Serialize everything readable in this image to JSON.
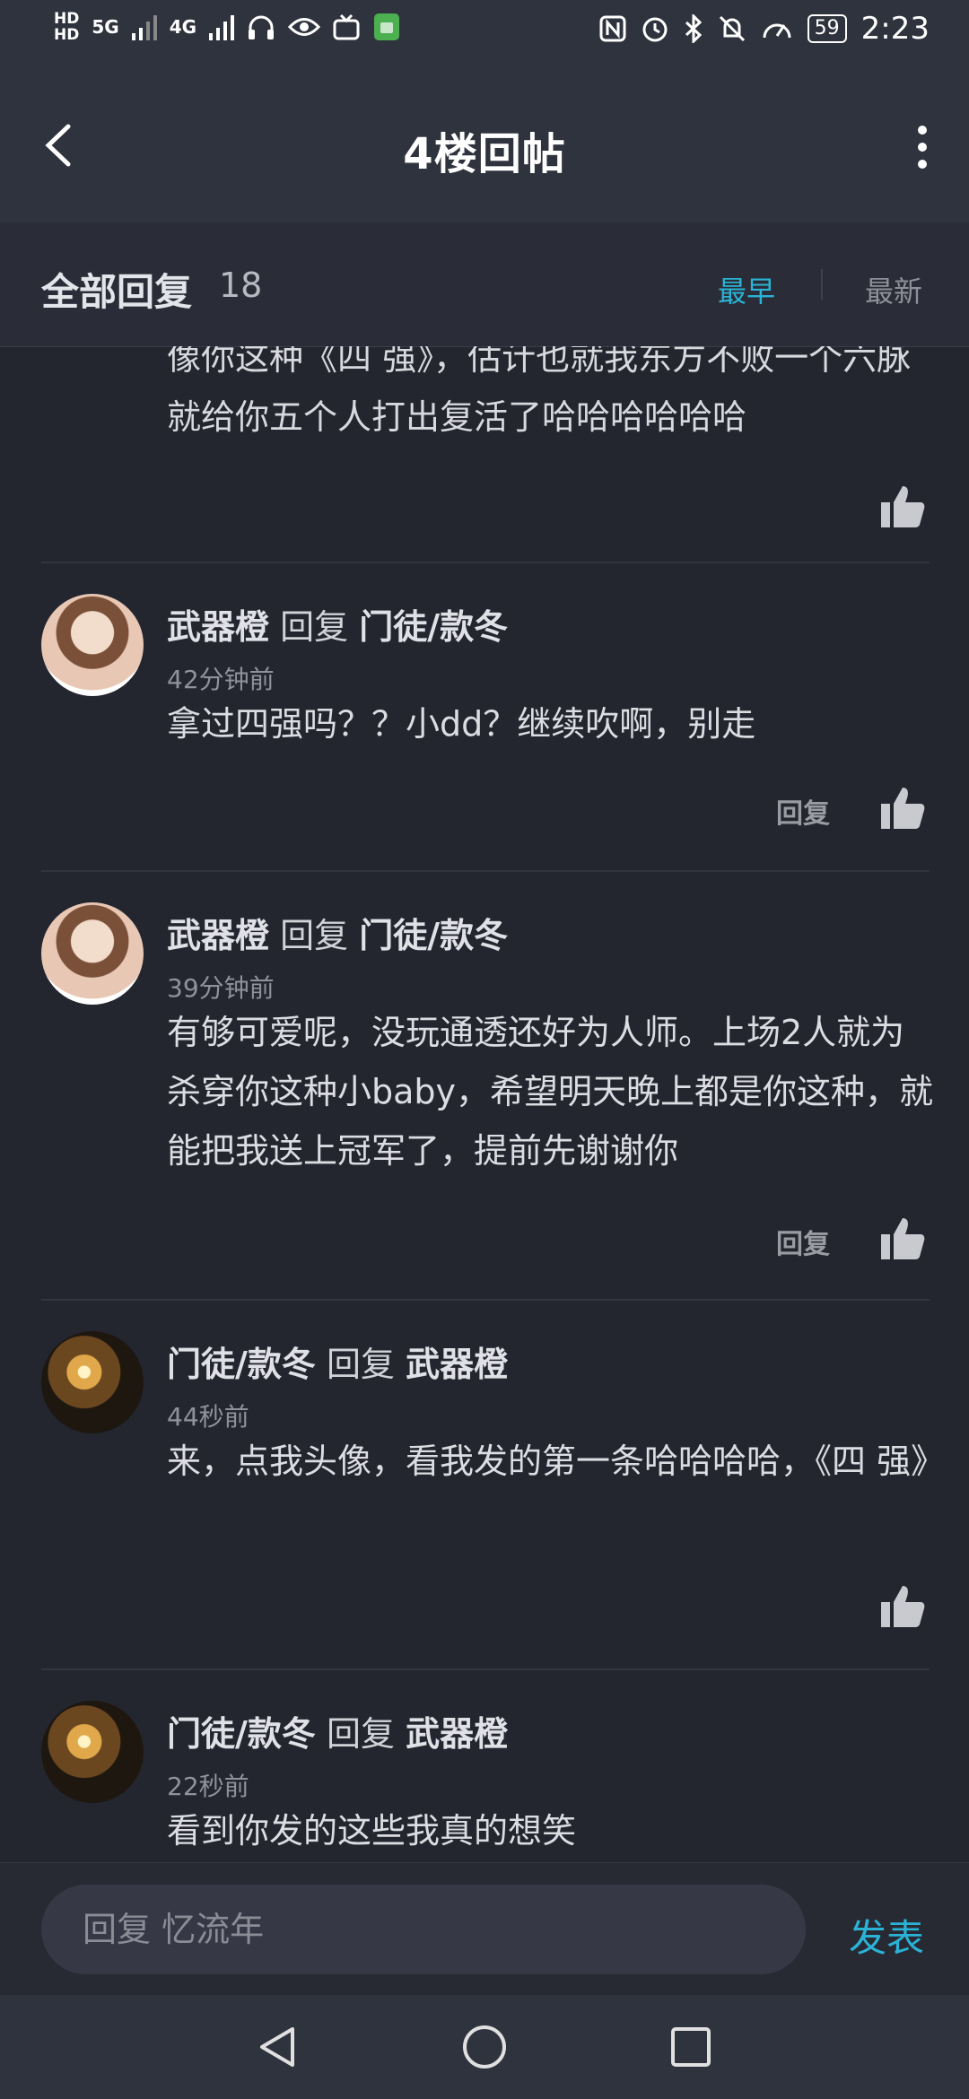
{
  "status_bar": {
    "hd1": "HD",
    "hd2": "HD",
    "sig1": "5G",
    "sig2": "4G",
    "battery": "59",
    "time": "2:23"
  },
  "header": {
    "title": "4楼回帖"
  },
  "subheader": {
    "all_replies": "全部回复",
    "count": "18",
    "tab_earliest": "最早",
    "tab_newest": "最新",
    "active_tab_color": "#2ab3d6"
  },
  "partial_comment": {
    "text": "像你这种《四 强》，估计也就我东方不败一个六脉就给你五个人打出复活了哈哈哈哈哈哈"
  },
  "comments": [
    {
      "user": "武器橙",
      "reply_word": "回复",
      "target": "门徒/款冬",
      "time": "42分钟前",
      "text": "拿过四强吗？？小dd？继续吹啊，别走",
      "reply_label": "回复"
    },
    {
      "user": "武器橙",
      "reply_word": "回复",
      "target": "门徒/款冬",
      "time": "39分钟前",
      "text": "有够可爱呢，没玩通透还好为人师。上场2人就为杀穿你这种小baby，希望明天晚上都是你这种，就能把我送上冠军了，提前先谢谢你",
      "reply_label": "回复"
    },
    {
      "user": "门徒/款冬",
      "reply_word": "回复",
      "target": "武器橙",
      "time": "44秒前",
      "text": "来，点我头像，看我发的第一条哈哈哈哈，《四 强》"
    },
    {
      "user": "门徒/款冬",
      "reply_word": "回复",
      "target": "武器橙",
      "time": "22秒前",
      "text": "看到你发的这些我真的想笑"
    }
  ],
  "composer": {
    "placeholder": "回复 忆流年",
    "send_label": "发表"
  }
}
